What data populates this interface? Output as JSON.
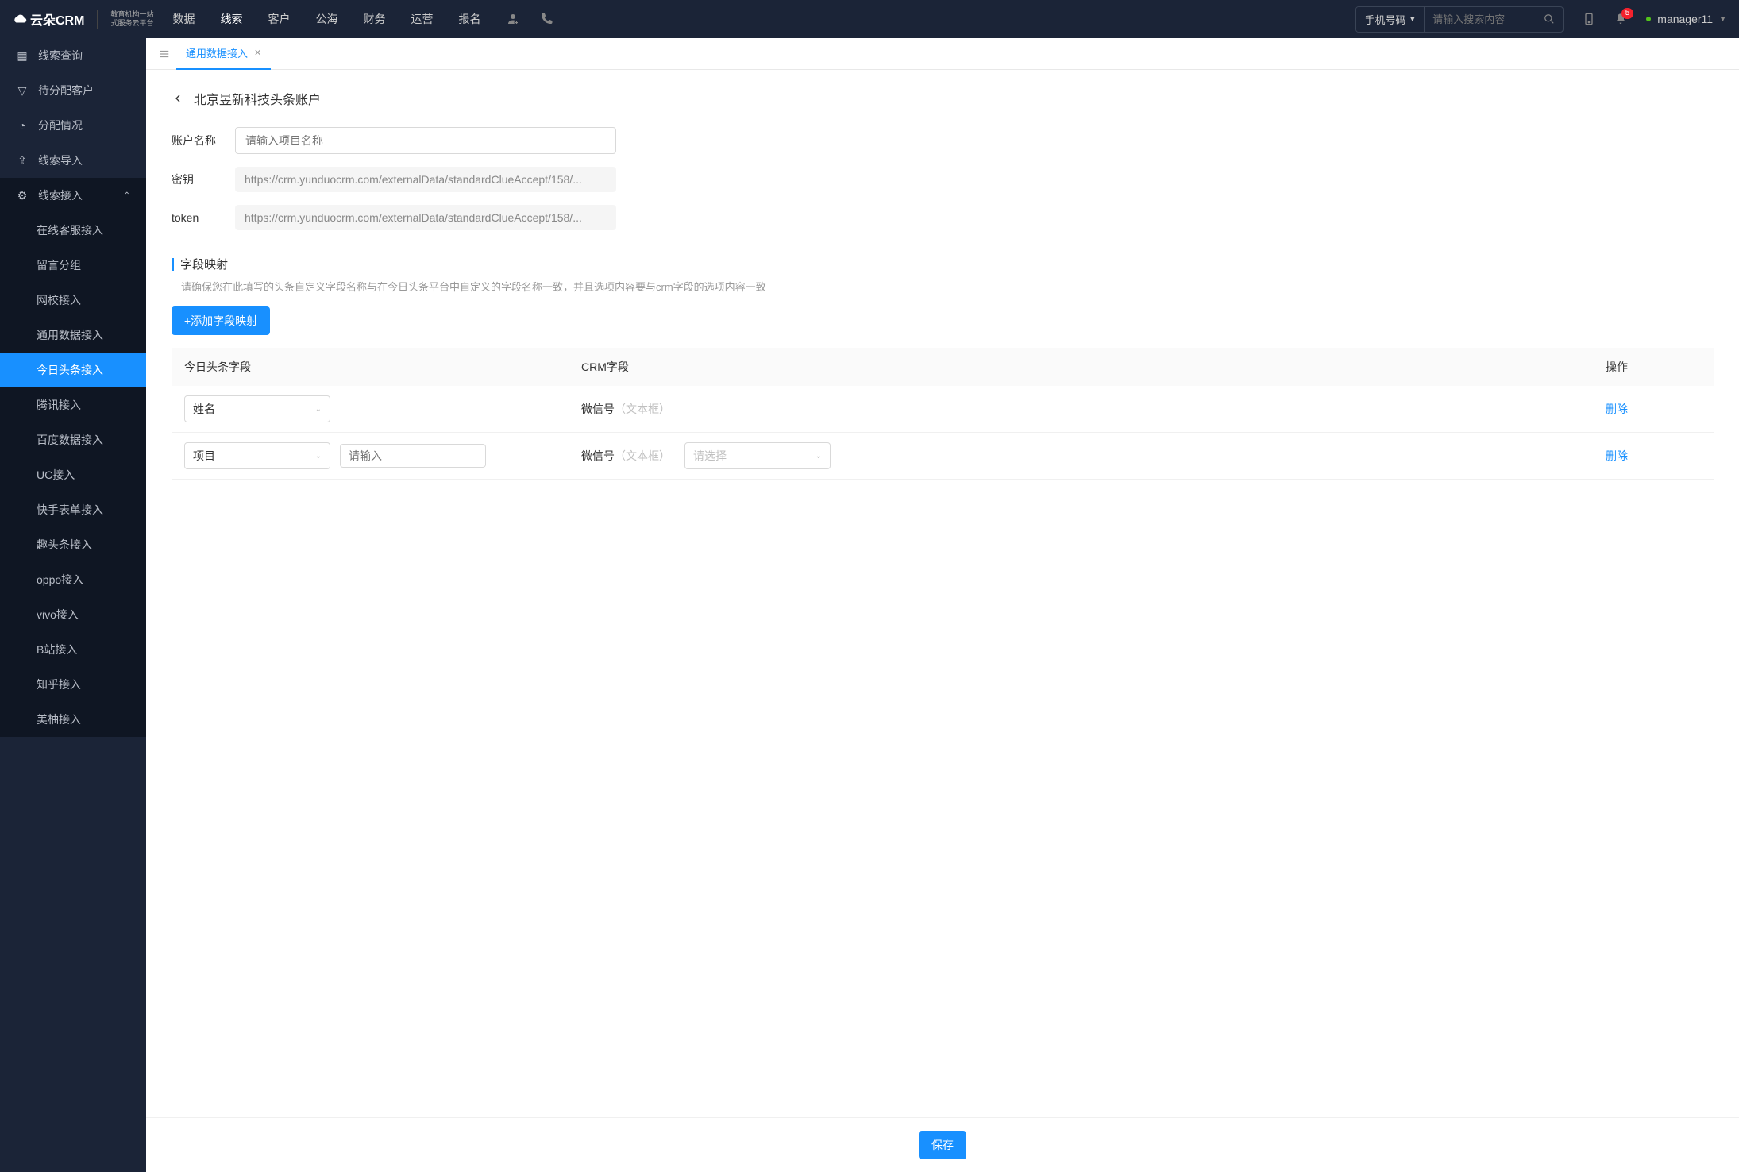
{
  "header": {
    "logo_main": "云朵CRM",
    "logo_sub1": "教育机构一站",
    "logo_sub2": "式服务云平台",
    "nav": [
      "数据",
      "线索",
      "客户",
      "公海",
      "财务",
      "运营",
      "报名"
    ],
    "nav_active_index": 1,
    "search_select": "手机号码",
    "search_placeholder": "请输入搜索内容",
    "notification_count": "5",
    "username": "manager11"
  },
  "sidebar": {
    "items": [
      {
        "label": "线索查询"
      },
      {
        "label": "待分配客户"
      },
      {
        "label": "分配情况"
      },
      {
        "label": "线索导入"
      },
      {
        "label": "线索接入",
        "expanded": true,
        "children": [
          "在线客服接入",
          "留言分组",
          "网校接入",
          "通用数据接入",
          "今日头条接入",
          "腾讯接入",
          "百度数据接入",
          "UC接入",
          "快手表单接入",
          "趣头条接入",
          "oppo接入",
          "vivo接入",
          "B站接入",
          "知乎接入",
          "美柚接入"
        ],
        "active_child": 4
      }
    ]
  },
  "tab": {
    "label": "通用数据接入"
  },
  "page": {
    "title": "北京昱新科技头条账户",
    "form": {
      "account_label": "账户名称",
      "account_placeholder": "请输入项目名称",
      "secret_label": "密钥",
      "secret_value": "https://crm.yunduocrm.com/externalData/standardClueAccept/158/...",
      "token_label": "token",
      "token_value": "https://crm.yunduocrm.com/externalData/standardClueAccept/158/..."
    },
    "section": {
      "title": "字段映射",
      "hint": "请确保您在此填写的头条自定义字段名称与在今日头条平台中自定义的字段名称一致，并且选项内容要与crm字段的选项内容一致",
      "add_btn": "+添加字段映射"
    },
    "table": {
      "headers": [
        "今日头条字段",
        "CRM字段",
        "操作"
      ],
      "rows": [
        {
          "field": "姓名",
          "crm": "微信号",
          "crm_hint": "（文本框）",
          "delete": "删除",
          "has_input": false,
          "has_select": false
        },
        {
          "field": "项目",
          "input_placeholder": "请输入",
          "crm": "微信号",
          "crm_hint": "（文本框）",
          "select_placeholder": "请选择",
          "delete": "删除",
          "has_input": true,
          "has_select": true
        }
      ]
    },
    "save_btn": "保存"
  }
}
